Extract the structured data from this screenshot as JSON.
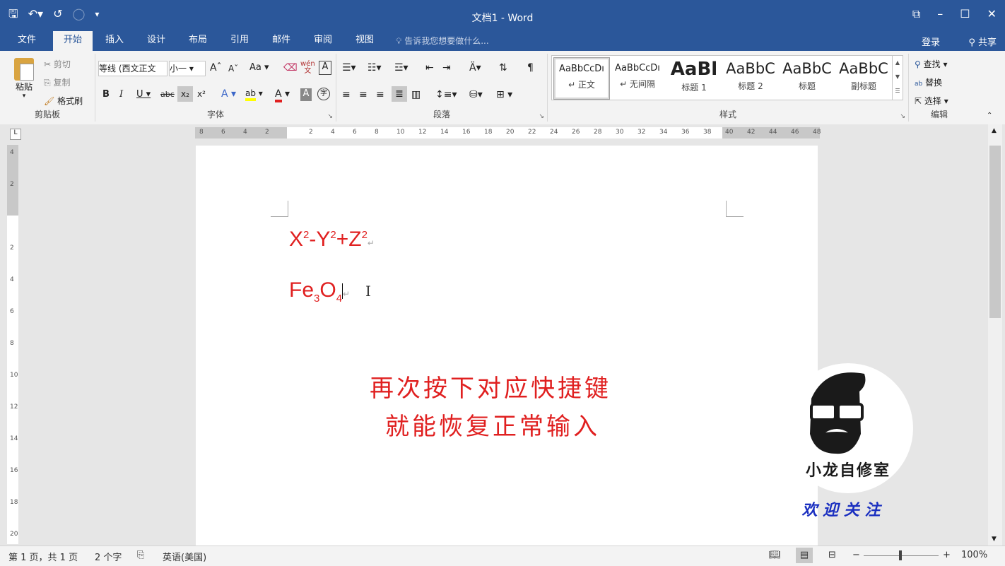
{
  "window": {
    "title": "文档1 - Word"
  },
  "tabs": [
    "文件",
    "开始",
    "插入",
    "设计",
    "布局",
    "引用",
    "邮件",
    "审阅",
    "视图"
  ],
  "tell_me": "告诉我您想要做什么...",
  "account": {
    "login": "登录",
    "share": "共享"
  },
  "clipboard": {
    "paste": "粘贴",
    "cut": "剪切",
    "copy": "复制",
    "format_painter": "格式刷",
    "label": "剪贴板"
  },
  "font": {
    "name": "等线 (西文正文",
    "size": "小一",
    "label": "字体",
    "bold": "B",
    "italic": "I",
    "underline": "U",
    "strike": "abc",
    "subscript": "x₂",
    "superscript": "x²",
    "change_case": "Aa",
    "pinyin": "wén\n文"
  },
  "paragraph": {
    "label": "段落"
  },
  "styles": {
    "label": "样式",
    "items": [
      {
        "preview": "AaBbCcDı",
        "name": "↵ 正文"
      },
      {
        "preview": "AaBbCcDı",
        "name": "↵ 无间隔"
      },
      {
        "preview": "AaBl",
        "name": "标题 1"
      },
      {
        "preview": "AaBbC",
        "name": "标题 2"
      },
      {
        "preview": "AaBbC",
        "name": "标题"
      },
      {
        "preview": "AaBbC",
        "name": "副标题"
      }
    ]
  },
  "editing": {
    "find": "查找",
    "replace": "替换",
    "select": "选择",
    "label": "编辑"
  },
  "ruler": {
    "h": [
      "8",
      "6",
      "4",
      "2",
      "",
      "2",
      "4",
      "6",
      "8",
      "10",
      "12",
      "14",
      "16",
      "18",
      "20",
      "22",
      "24",
      "26",
      "28",
      "30",
      "32",
      "34",
      "36",
      "38",
      "40",
      "42",
      "44",
      "46",
      "48"
    ],
    "v": [
      "4",
      "2",
      "",
      "2",
      "4",
      "6",
      "8",
      "10",
      "12",
      "14",
      "16",
      "18",
      "20"
    ]
  },
  "document": {
    "formula1": {
      "x": "X",
      "y": "Y",
      "z": "Z",
      "exp": "2",
      "minus": "-",
      "plus": "+"
    },
    "formula2": {
      "fe": "Fe",
      "three": "3",
      "o": "O",
      "four": "4"
    },
    "caption_line1": "再次按下对应快捷键",
    "caption_line2": "就能恢复正常输入"
  },
  "watermark": {
    "brand": "小龙自修室",
    "follow": "欢 迎 关 注"
  },
  "status": {
    "page": "第 1 页，共 1 页",
    "words": "2 个字",
    "language": "英语(美国)",
    "zoom": "100%"
  },
  "colors": {
    "accent": "#2b579a",
    "red": "#e02020",
    "follow": "#1a2fc0"
  }
}
